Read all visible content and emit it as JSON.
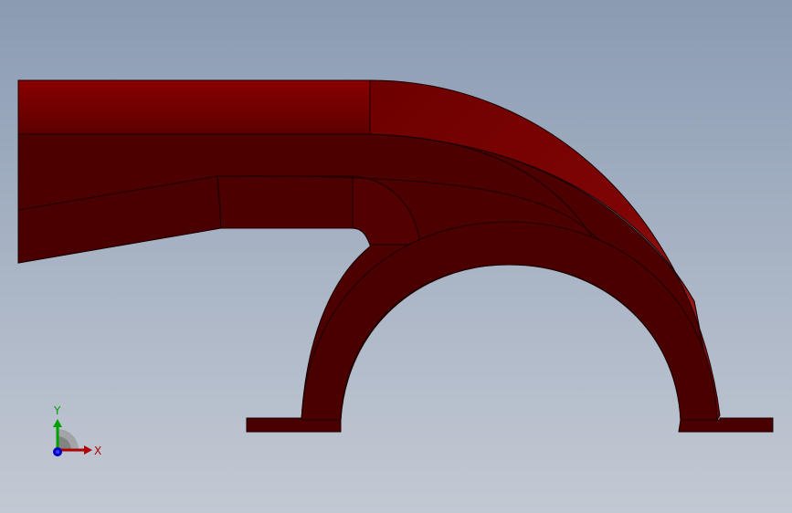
{
  "viewport": {
    "background_top": "#8a9bb2",
    "background_bottom": "#c3c9d3"
  },
  "model": {
    "face_color_dark": "#4a0000",
    "face_color_mid": "#7a0000",
    "face_color_highlight": "#8e1414",
    "edge_color": "#1a0000"
  },
  "triad": {
    "x_label": "X",
    "y_label": "Y",
    "x_color": "#b00000",
    "y_color": "#00a000",
    "z_color": "#0000c0"
  }
}
